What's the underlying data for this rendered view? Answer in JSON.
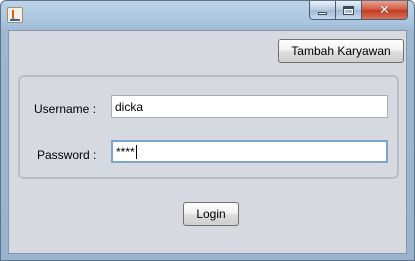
{
  "window": {
    "icon": "java-app-icon",
    "controls": {
      "minimize": "minimize-icon",
      "maximize": "maximize-icon",
      "close": "close-icon"
    }
  },
  "toolbar": {
    "tambah_label": "Tambah Karyawan"
  },
  "form": {
    "username_label": "Username :",
    "username_value": "dicka",
    "password_label": "Password :",
    "password_value": "****"
  },
  "actions": {
    "login_label": "Login"
  }
}
